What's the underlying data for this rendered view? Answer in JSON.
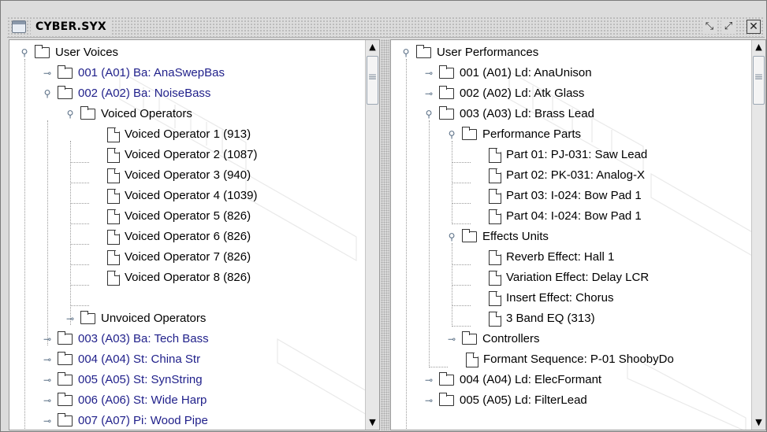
{
  "window": {
    "title": "CYBER.SYX",
    "controls": {
      "minimize_glyph": "⤡",
      "maximize_glyph": "⤢",
      "close_glyph": "✕"
    }
  },
  "left_tree": {
    "root": "User Voices",
    "items": [
      {
        "label": "001 (A01)  Ba: AnaSwepBas",
        "link": true
      },
      {
        "label": "002 (A02)  Ba: NoiseBass",
        "link": true
      },
      {
        "label": "Voiced Operators"
      },
      {
        "label": "Voiced Operator 1 (913)"
      },
      {
        "label": "Voiced Operator 2 (1087)"
      },
      {
        "label": "Voiced Operator 3 (940)"
      },
      {
        "label": "Voiced Operator 4 (1039)"
      },
      {
        "label": "Voiced Operator 5 (826)"
      },
      {
        "label": "Voiced Operator 6 (826)"
      },
      {
        "label": "Voiced Operator 7 (826)"
      },
      {
        "label": "Voiced Operator 8 (826)"
      },
      {
        "label": "Unvoiced Operators"
      },
      {
        "label": "003 (A03)  Ba: Tech Bass",
        "link": true
      },
      {
        "label": "004 (A04)  St: China Str",
        "link": true
      },
      {
        "label": "005 (A05)  St: SynString",
        "link": true
      },
      {
        "label": "006 (A06)  St: Wide Harp",
        "link": true
      },
      {
        "label": "007 (A07)  Pi: Wood Pipe",
        "link": true
      }
    ]
  },
  "right_tree": {
    "root": "User Performances",
    "items": [
      {
        "label": "001 (A01)  Ld: AnaUnison"
      },
      {
        "label": "002 (A02)  Ld: Atk Glass"
      },
      {
        "label": "003 (A03)  Ld: Brass Lead"
      },
      {
        "label": "Performance Parts"
      },
      {
        "label": "Part 01: PJ-031: Saw Lead"
      },
      {
        "label": "Part 02: PK-031: Analog-X"
      },
      {
        "label": "Part 03: I-024: Bow Pad 1"
      },
      {
        "label": "Part 04: I-024: Bow Pad 1"
      },
      {
        "label": "Effects Units"
      },
      {
        "label": "Reverb Effect: Hall 1"
      },
      {
        "label": "Variation Effect: Delay LCR"
      },
      {
        "label": "Insert Effect: Chorus"
      },
      {
        "label": "3 Band EQ (313)"
      },
      {
        "label": "Controllers"
      },
      {
        "label": "Formant Sequence: P-01 ShoobyDo"
      },
      {
        "label": "004 (A04)  Ld: ElecFormant"
      },
      {
        "label": "005 (A05)  Ld: FilterLead"
      }
    ]
  },
  "scrollbar": {
    "up_glyph": "▲",
    "down_glyph": "▼"
  },
  "icons": {
    "expanded": "expanded-handle-icon",
    "collapsed": "collapsed-handle-icon",
    "folder": "folder-icon",
    "document": "document-icon"
  }
}
